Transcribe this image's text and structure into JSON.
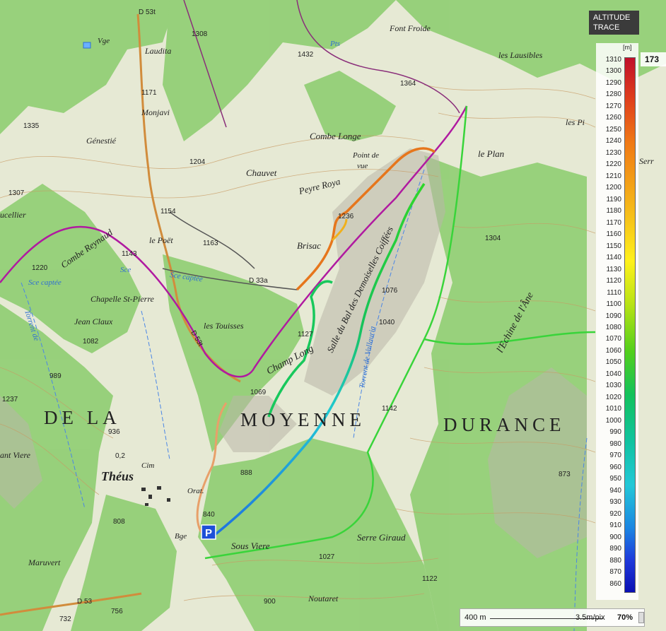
{
  "legend": {
    "title_line1": "ALTITUDE",
    "title_line2": "TRACE",
    "unit": "[m]",
    "ticks": [
      "1310",
      "1300",
      "1290",
      "1280",
      "1270",
      "1260",
      "1250",
      "1240",
      "1230",
      "1220",
      "1210",
      "1200",
      "1190",
      "1180",
      "1170",
      "1160",
      "1150",
      "1140",
      "1130",
      "1120",
      "1110",
      "1100",
      "1090",
      "1080",
      "1070",
      "1060",
      "1050",
      "1040",
      "1030",
      "1020",
      "1010",
      "1000",
      "990",
      "980",
      "970",
      "960",
      "950",
      "940",
      "930",
      "920",
      "910",
      "900",
      "890",
      "880",
      "870",
      "860"
    ],
    "color_high": "#c0102a",
    "color_low": "#0a0fb3"
  },
  "scale": {
    "distance": "400 m",
    "resolution": "3.5m/pix",
    "zoom": "70%"
  },
  "corner_value": "173",
  "places": {
    "vge": "Vge",
    "laudita": "Laudita",
    "d53t": "D 53t",
    "v1308": "1308",
    "font_froide": "Font Froide",
    "v1432": "1432",
    "pts": "Pts",
    "les_lausibles": "les Lausibles",
    "v1171": "1171",
    "monjavi": "Monjavi",
    "v1364": "1364",
    "v1335": "1335",
    "genestie": "Génestié",
    "combe_longe": "Combe Longe",
    "les_pi": "les Pi",
    "v1204": "1204",
    "chauvet": "Chauvet",
    "point_de": "Point de",
    "vue": "vue",
    "le_plan": "le Plan",
    "serr": "Serr",
    "v1307": "1307",
    "ucellier": "ucellier",
    "peyre_roya": "Peyre Roya",
    "v1154": "1154",
    "combe_reynaud": "Combe Reynaud",
    "le_poet": "le Poët",
    "v1163": "1163",
    "v1236": "1236",
    "brisac": "Brisac",
    "v1304": "1304",
    "v1143": "1143",
    "sce": "Sce",
    "sce_captee": "Sce captée",
    "v1220": "1220",
    "d33a": "D 33a",
    "chapelle": "Chapelle St-Pierre",
    "v1076": "1076",
    "jean_claux": "Jean Claux",
    "les_touisses": "les Touisses",
    "v1040": "1040",
    "v1082": "1082",
    "v1127": "1127",
    "champ_long": "Champ Long",
    "salle_bal": "Salle du Bal des Demoiselles Coiffées",
    "torrent_vallauria": "Torrent de Vallauria",
    "echine": "l'Echine de l'Âne",
    "torrent_de": "Torrent de",
    "d53t2": "D 53t",
    "v989": "989",
    "v1069": "1069",
    "v1237": "1237",
    "de_la": "DE LA",
    "moyenne": "MOYENNE",
    "durance": "DURANCE",
    "v1142": "1142",
    "v936": "936",
    "ant_viere": "ant Viere",
    "v0_2": "0,2",
    "theus": "Théus",
    "cim": "Cim",
    "v888": "888",
    "v873": "873",
    "orat": "Orat.",
    "v840": "840",
    "v808": "808",
    "bge": "Bge",
    "sous_viere": "Sous Viere",
    "serre_giraud": "Serre Giraud",
    "maruvert": "Maruvert",
    "v1027": "1027",
    "v1122": "1122",
    "d53": "D 53",
    "v756": "756",
    "v732": "732",
    "noutaret": "Noutaret",
    "v900": "900"
  }
}
